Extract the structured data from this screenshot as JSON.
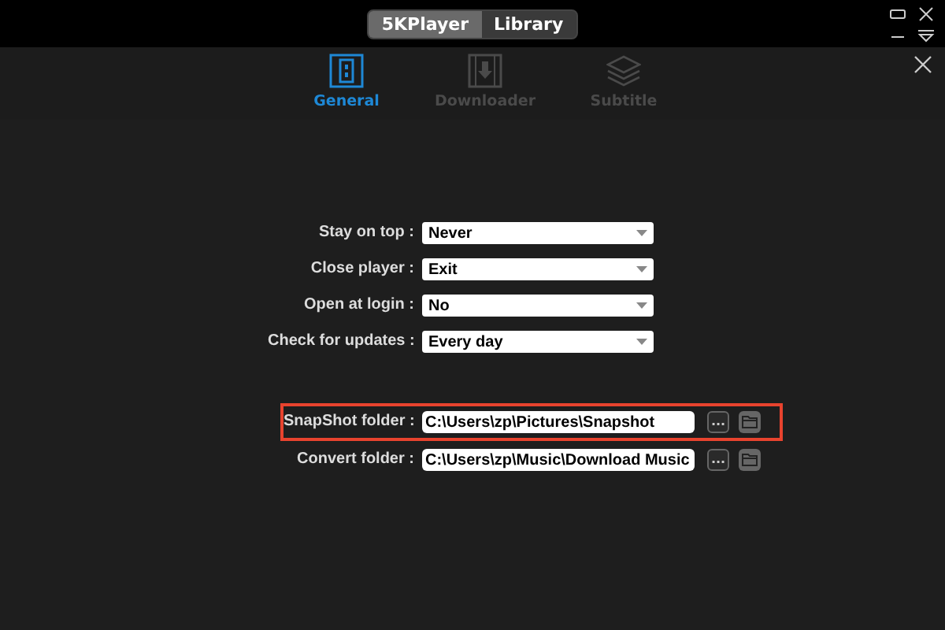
{
  "top_bar": {
    "switch": [
      {
        "label": "5KPlayer",
        "selected": true
      },
      {
        "label": "Library",
        "selected": false
      }
    ]
  },
  "tabs": [
    {
      "label": "General",
      "selected": true
    },
    {
      "label": "Downloader",
      "selected": false
    },
    {
      "label": "Subtitle",
      "selected": false
    }
  ],
  "options": [
    {
      "label": "Stay on top :",
      "value": "Never"
    },
    {
      "label": "Close player :",
      "value": "Exit"
    },
    {
      "label": "Open at login :",
      "value": "No"
    },
    {
      "label": "Check for updates :",
      "value": "Every day"
    }
  ],
  "folders": [
    {
      "label": "SnapShot folder :",
      "value": "C:\\Users\\zp\\Pictures\\Snapshot",
      "browse": "...",
      "highlighted": true
    },
    {
      "label": "Convert folder :",
      "value": "C:\\Users\\zp\\Music\\Download Music",
      "browse": "...",
      "highlighted": false
    }
  ]
}
